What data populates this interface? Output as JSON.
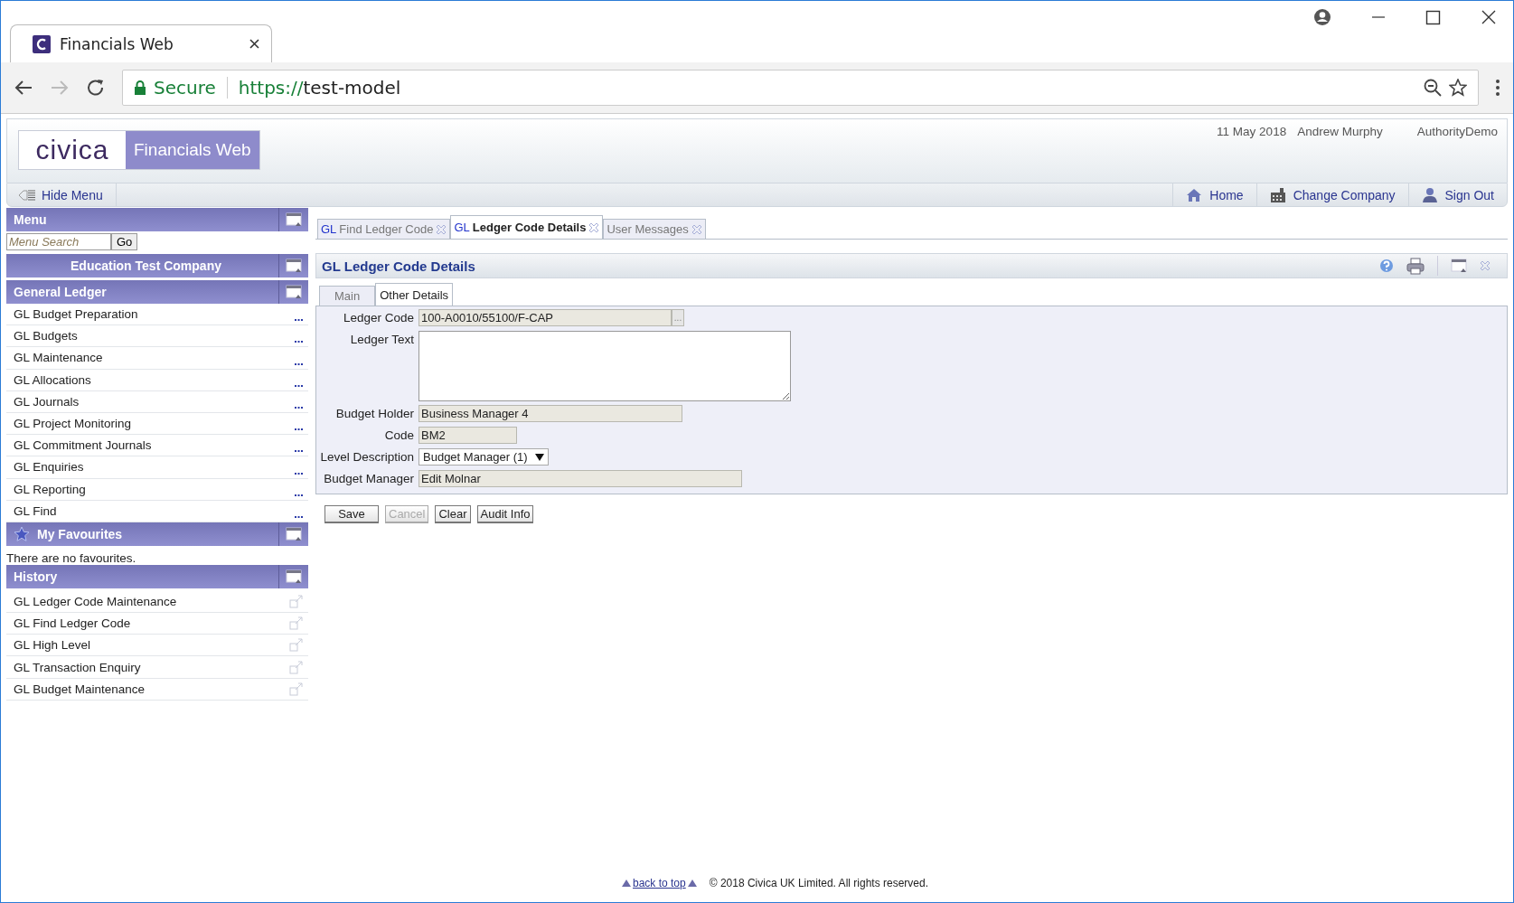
{
  "browser": {
    "tab_title": "Financials Web",
    "security": "Secure",
    "url_scheme": "https://",
    "url_host": "test-model"
  },
  "header": {
    "logo": "civica",
    "product": "Financials Web",
    "date": "11 May 2018",
    "user": "Andrew Murphy",
    "authority": "AuthorityDemo"
  },
  "nav": {
    "hide_menu": "Hide Menu",
    "links": [
      {
        "kind": "home",
        "label": "Home"
      },
      {
        "kind": "company",
        "label": "Change Company"
      },
      {
        "kind": "signout",
        "label": "Sign Out"
      }
    ]
  },
  "sidebar": {
    "menu_title": "Menu",
    "search_placeholder": "Menu Search",
    "go": "Go",
    "company": "Education Test Company",
    "section": "General Ledger",
    "items": [
      "GL Budget Preparation",
      "GL Budgets",
      "GL Maintenance",
      "GL Allocations",
      "GL Journals",
      "GL Project Monitoring",
      "GL Commitment Journals",
      "GL Enquiries",
      "GL Reporting",
      "GL Find"
    ],
    "favourites_title": "My Favourites",
    "favourites_empty": "There are no favourites.",
    "history_title": "History",
    "history": [
      "GL Ledger Code Maintenance",
      "GL Find Ledger Code",
      "GL High Level",
      "GL Transaction Enquiry",
      "GL Budget Maintenance"
    ]
  },
  "tabs": [
    {
      "prefix": "GL",
      "label": "Find Ledger Code",
      "selected": false
    },
    {
      "prefix": "GL",
      "label": "Ledger Code Details",
      "selected": true
    },
    {
      "label": "User Messages",
      "selected": false
    }
  ],
  "page": {
    "title": "GL Ledger Code Details",
    "subtabs": [
      {
        "label": "Main",
        "selected": false
      },
      {
        "label": "Other Details",
        "selected": true
      }
    ],
    "fields": [
      {
        "kind": "lookup",
        "label": "Ledger Code",
        "value": "100-A0010/55100/F-CAP",
        "lookup_button": "..."
      },
      {
        "kind": "textarea",
        "label": "Ledger Text"
      },
      {
        "kind": "text",
        "label": "Budget Holder",
        "value": "Business Manager 4"
      },
      {
        "kind": "text",
        "label": "Code",
        "value": "BM2"
      },
      {
        "kind": "select",
        "label": "Level Description",
        "value": "Budget Manager (1)"
      },
      {
        "kind": "text",
        "label": "Budget Manager",
        "value": "Edit Molnar"
      }
    ],
    "buttons": [
      {
        "label": "Save",
        "disabled": false
      },
      {
        "label": "Cancel",
        "disabled": true
      },
      {
        "label": "Clear",
        "disabled": false
      },
      {
        "label": "Audit Info",
        "disabled": false
      }
    ]
  },
  "footer": {
    "back_to_top": "back to top",
    "copyright": "© 2018 Civica UK Limited. All rights reserved."
  }
}
